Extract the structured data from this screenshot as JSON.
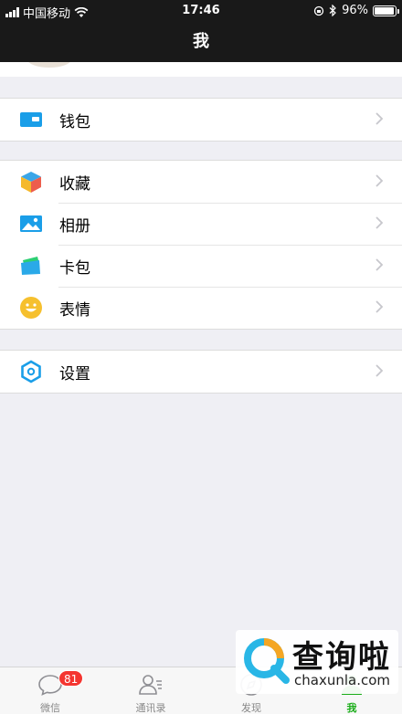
{
  "status_bar": {
    "carrier": "中国移动",
    "time": "17:46",
    "battery": "96%"
  },
  "nav": {
    "title": "我"
  },
  "menu": {
    "wallet": "钱包",
    "favorites": "收藏",
    "album": "相册",
    "cards": "卡包",
    "stickers": "表情",
    "settings": "设置"
  },
  "tabs": [
    {
      "label": "微信",
      "badge": "81"
    },
    {
      "label": "通讯录"
    },
    {
      "label": "发现"
    },
    {
      "label": "我"
    }
  ],
  "colors": {
    "active": "#1aad19",
    "badge": "#f43530",
    "bar": "#191919",
    "icon_blue": "#1a9ee8"
  },
  "watermark": {
    "cn": "查询啦",
    "en": "chaxunla.com"
  }
}
